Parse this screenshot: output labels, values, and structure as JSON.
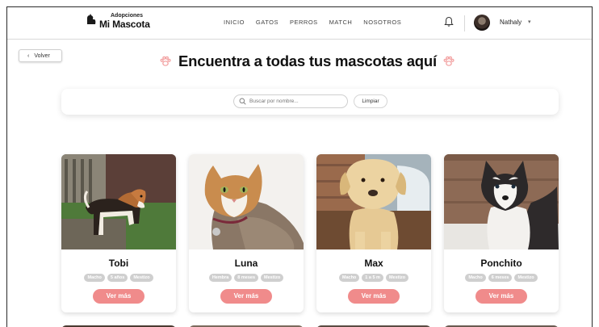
{
  "brand": {
    "top": "Adopciones",
    "main": "Mi Mascota"
  },
  "nav": [
    "INICIO",
    "GATOS",
    "PERROS",
    "MATCH",
    "NOSOTROS"
  ],
  "user": {
    "name": "Nathaly"
  },
  "back_label": "Volver",
  "headline": "Encuentra a todas tus mascotas aquí",
  "search": {
    "placeholder": "Buscar por nombre...",
    "clear_label": "Limpiar"
  },
  "pets": [
    {
      "name": "Tobi",
      "tags": [
        "Macho",
        "5 años",
        "Mestizo"
      ],
      "button": "Ver más"
    },
    {
      "name": "Luna",
      "tags": [
        "Hembra",
        "8 meses",
        "Mestizo"
      ],
      "button": "Ver más"
    },
    {
      "name": "Max",
      "tags": [
        "Macho",
        "1 a 5 m",
        "Mestizo"
      ],
      "button": "Ver más"
    },
    {
      "name": "Ponchito",
      "tags": [
        "Macho",
        "6 meses",
        "Mestizo"
      ],
      "button": "Ver más"
    }
  ],
  "colors": {
    "accent": "#f08b8b",
    "tag": "#cfcfcf",
    "paw": "#f3a3a3"
  },
  "icons": {
    "bell": "bell-icon",
    "search": "search-icon",
    "paw": "paw-icon",
    "back": "chevron-left-icon",
    "caret": "chevron-down-icon"
  }
}
